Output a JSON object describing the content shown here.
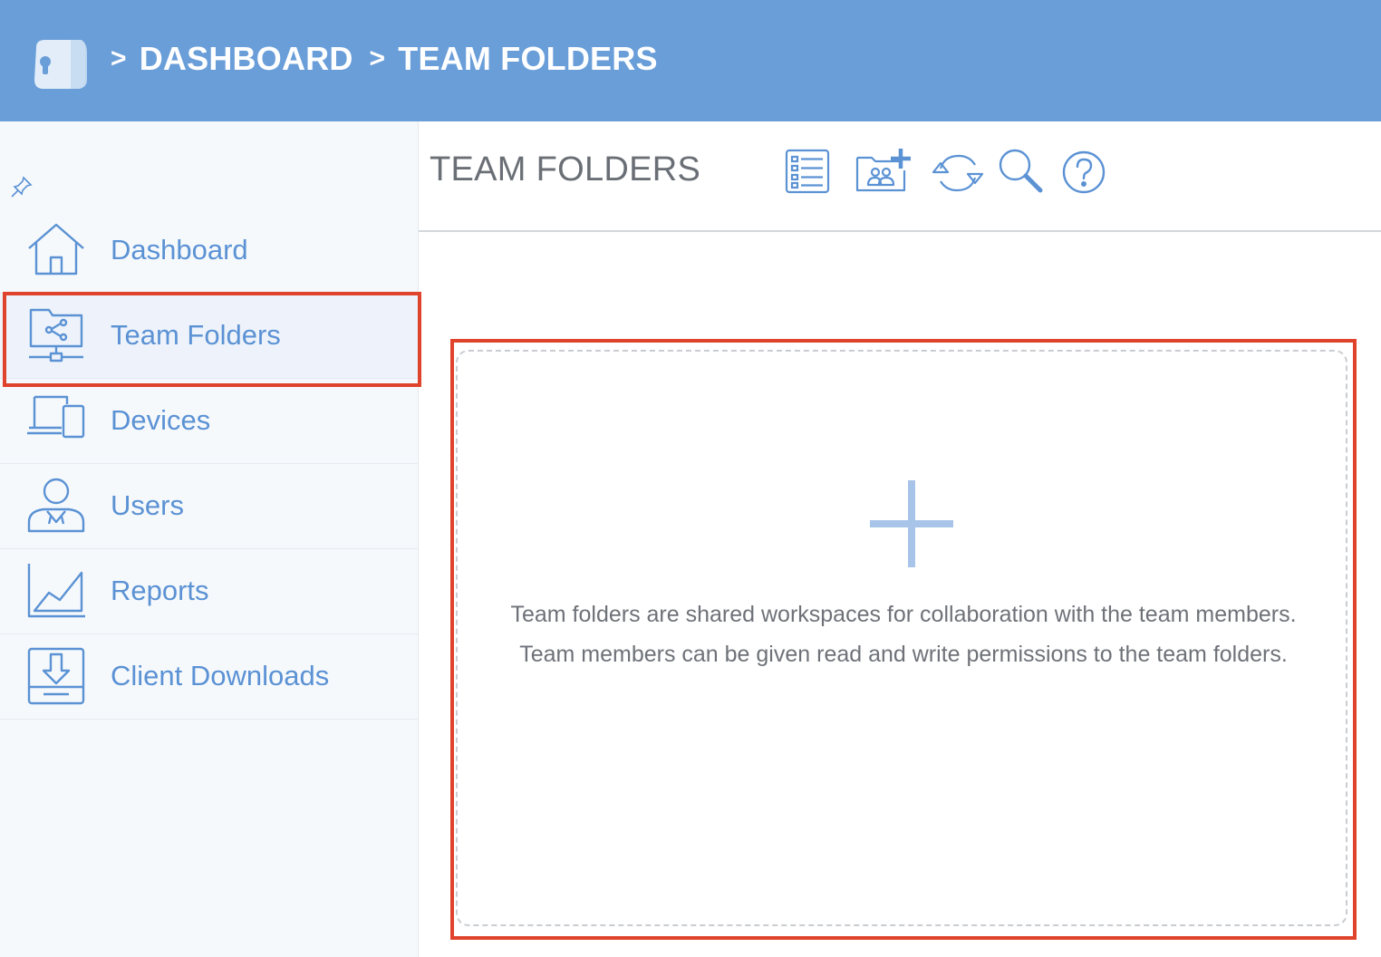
{
  "header": {
    "breadcrumbs": [
      {
        "sep": ">",
        "label": "DASHBOARD"
      },
      {
        "sep": ">",
        "label": "TEAM FOLDERS"
      }
    ]
  },
  "sidebar": {
    "items": [
      {
        "label": "Dashboard",
        "icon": "house-icon"
      },
      {
        "label": "Team Folders",
        "icon": "shared-folder-icon",
        "active": true
      },
      {
        "label": "Devices",
        "icon": "devices-icon"
      },
      {
        "label": "Users",
        "icon": "user-icon"
      },
      {
        "label": "Reports",
        "icon": "chart-icon"
      },
      {
        "label": "Client Downloads",
        "icon": "download-icon"
      }
    ]
  },
  "main": {
    "title": "TEAM FOLDERS",
    "toolbar": [
      "list-view-icon",
      "add-team-folder-icon",
      "refresh-icon",
      "search-icon",
      "help-icon"
    ],
    "empty_state": {
      "line1": "Team folders are shared workspaces for collaboration with the team members.",
      "line2": "Team members can be given read and write permissions to the team folders."
    }
  },
  "colors": {
    "header_bg": "#6a9ed9",
    "accent": "#5b92d4",
    "highlight": "#e0432c"
  }
}
